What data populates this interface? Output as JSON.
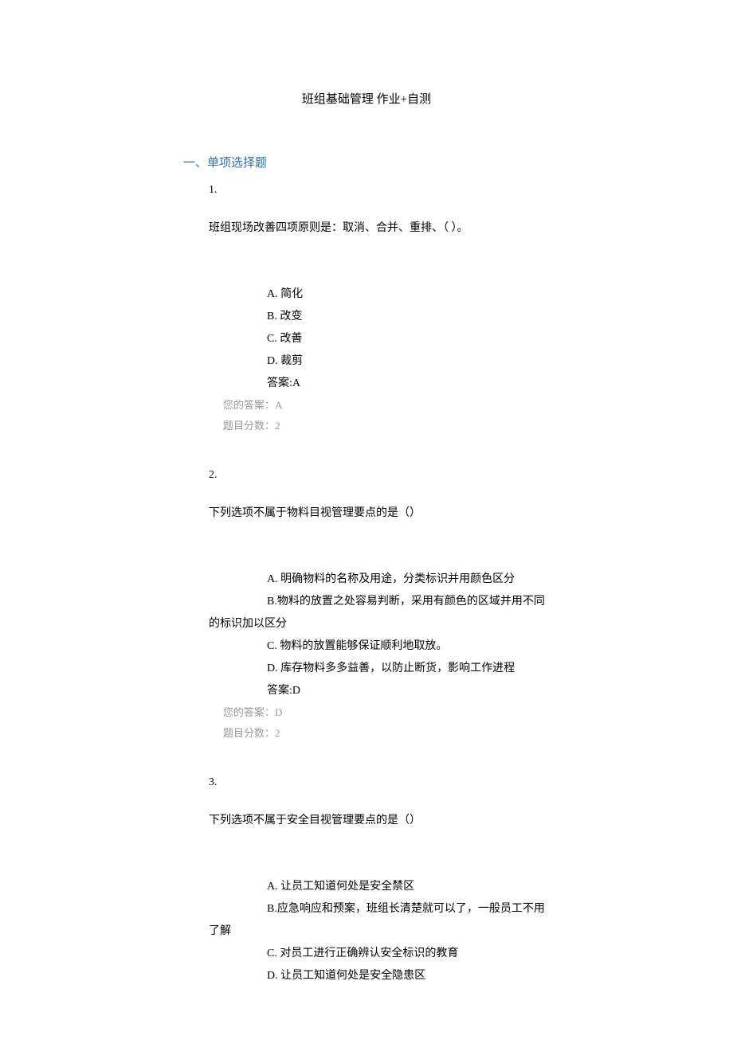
{
  "title": "班组基础管理 作业+自测",
  "section_heading": "一、单项选择题",
  "questions": [
    {
      "number": "1.",
      "stem": "班组现场改善四项原则是：取消、合并、重排、（   ）。",
      "options": [
        "A. 简化",
        "B. 改变",
        "C. 改善",
        "D. 裁剪"
      ],
      "correct": "答案:A",
      "your": "您的答案：A",
      "score": "题目分数：2"
    },
    {
      "number": "2.",
      "stem": "下列选项不属于物料目视管理要点的是（）",
      "options": [
        "A. 明确物料的名称及用途，分类标识并用颜色区分",
        "B.物料的放置之处容易判断，采用有颜色的区域并用不同的标识加以区分",
        "C. 物料的放置能够保证顺利地取放。",
        "D. 库存物料多多益善，以防止断货，影响工作进程"
      ],
      "correct": "答案:D",
      "your": "您的答案：D",
      "score": "题目分数：2"
    },
    {
      "number": "3.",
      "stem": "下列选项不属于安全目视管理要点的是（）",
      "options": [
        "A. 让员工知道何处是安全禁区",
        "B.应急响应和预案，班组长清楚就可以了，一般员工不用了解",
        "C. 对员工进行正确辨认安全标识的教育",
        "D. 让员工知道何处是安全隐患区"
      ],
      "correct": "",
      "your": "",
      "score": ""
    }
  ]
}
